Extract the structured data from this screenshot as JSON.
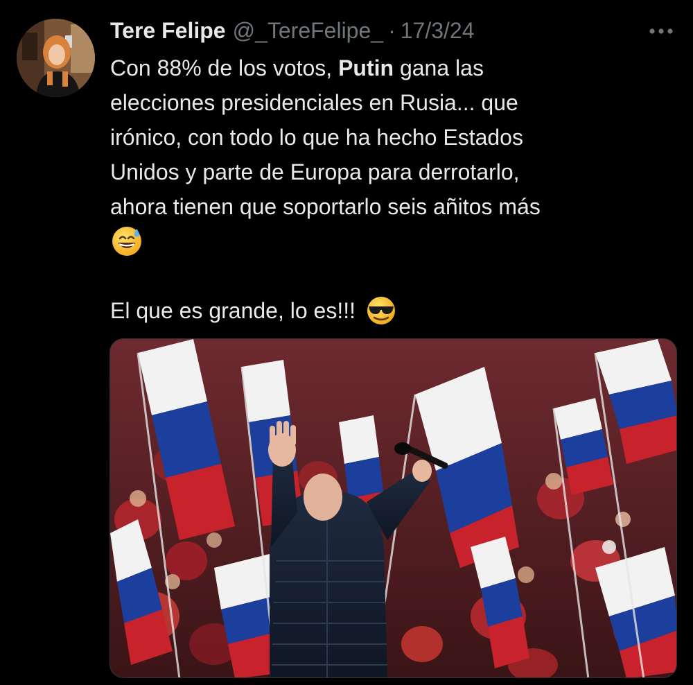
{
  "tweet": {
    "author": {
      "display_name": "Tere Felipe",
      "handle": "@_TereFelipe_",
      "avatar_icon": "profile-photo-avatar"
    },
    "separator": "·",
    "date": "17/3/24",
    "more_icon": "more-horizontal-icon",
    "text": {
      "line1_pre": "Con 88% de los votos, ",
      "line1_bold": "Putin",
      "line1_post": " gana las",
      "line2": "elecciones presidenciales en Rusia... que",
      "line3": "irónico, con todo lo que ha hecho Estados",
      "line4": "Unidos y parte de Europa para derrotarlo,",
      "line5": "ahora tienen que soportarlo seis añitos más",
      "emoji1": "grinning-face-with-sweat-emoji",
      "line7": "El que es grande, lo es!!!",
      "emoji2": "smiling-face-with-sunglasses-emoji"
    },
    "media": {
      "type": "photo",
      "description_icon": "rally-photo-flags-crowd"
    },
    "colors": {
      "background": "#000000",
      "text_primary": "#e7e9ea",
      "text_secondary": "#71767b",
      "flag_white": "#f2f2f2",
      "flag_blue": "#1c3f9e",
      "flag_red": "#c8232c"
    }
  }
}
